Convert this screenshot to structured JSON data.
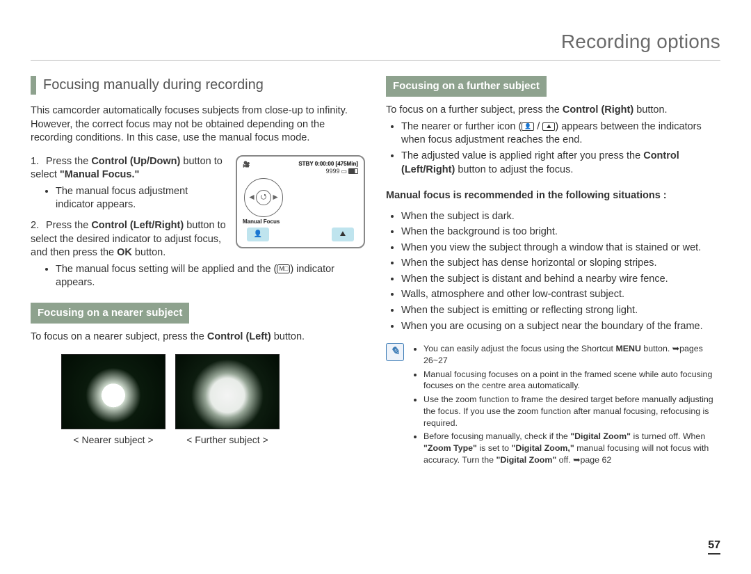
{
  "page": {
    "title": "Recording options",
    "number": "57"
  },
  "left": {
    "heading": "Focusing manually during recording",
    "intro": "This camcorder automatically focuses subjects from close-up to infinity. However, the correct focus may not be obtained depending on the recording conditions. In this case, use the manual focus mode.",
    "step1_a": "Press the ",
    "step1_b": "Control (Up/Down)",
    "step1_c": " button to select ",
    "step1_d": "\"Manual Focus.\"",
    "step1_bullet": "The manual focus adjustment indicator appears.",
    "step2_a": "Press the ",
    "step2_b": "Control (Left/Right)",
    "step2_c": " button to select the desired indicator to adjust focus, and then press the ",
    "step2_d": "OK",
    "step2_e": " button.",
    "step2_bullet_a": "The manual focus setting will be applied and the (",
    "step2_bullet_b": ") indicator appears.",
    "banner": "Focusing on a nearer subject",
    "nearer_a": "To focus on a nearer subject, press the ",
    "nearer_b": "Control (Left)",
    "nearer_c": " button.",
    "cap_near": "< Nearer subject >",
    "cap_far": "< Further subject >",
    "screen": {
      "stby": "STBY 0:00:00 [475Min]",
      "mf": "Manual Focus"
    }
  },
  "right": {
    "banner": "Focusing on a further subject",
    "line1_a": "To focus on a further subject, press the ",
    "line1_b": "Control (Right)",
    "line1_c": " button.",
    "b1_a": "The nearer or further icon (",
    "b1_b": " / ",
    "b1_c": ") appears between the indicators when focus adjustment reaches the end.",
    "b2_a": "The adjusted value is applied right after you press the ",
    "b2_b": "Control (Left/Right)",
    "b2_c": " button to adjust the focus.",
    "rec_heading": "Manual focus is recommended in the following situations :",
    "items": [
      "When the subject is dark.",
      "When the background is too bright.",
      "When you view the subject through a window that is stained or wet.",
      "When the subject has dense horizontal or sloping stripes.",
      "When the subject is distant and behind a nearby wire fence.",
      "Walls, atmosphere and other low-contrast subject.",
      "When the subject is emitting or reflecting strong light.",
      "When you are ocusing on a subject near the boundary of the frame."
    ],
    "notes": {
      "n1_a": "You can easily adjust the focus using the Shortcut ",
      "n1_b": "MENU",
      "n1_c": " button. ➥pages 26~27",
      "n2": "Manual focusing focuses on a point in the framed scene while auto focusing focuses on the centre area automatically.",
      "n3": "Use the zoom function to frame the desired target before manually adjusting the focus. If you use the zoom function after manual focusing, refocusing is required.",
      "n4_a": "Before focusing manually, check if the ",
      "n4_b": "\"Digital Zoom\"",
      "n4_c": " is turned off. When ",
      "n4_d": "\"Zoom Type\"",
      "n4_e": " is set to ",
      "n4_f": "\"Digital Zoom,\"",
      "n4_g": " manual focusing will not focus with accuracy. Turn the ",
      "n4_h": "\"Digital Zoom\"",
      "n4_i": " off. ➥page 62"
    }
  }
}
